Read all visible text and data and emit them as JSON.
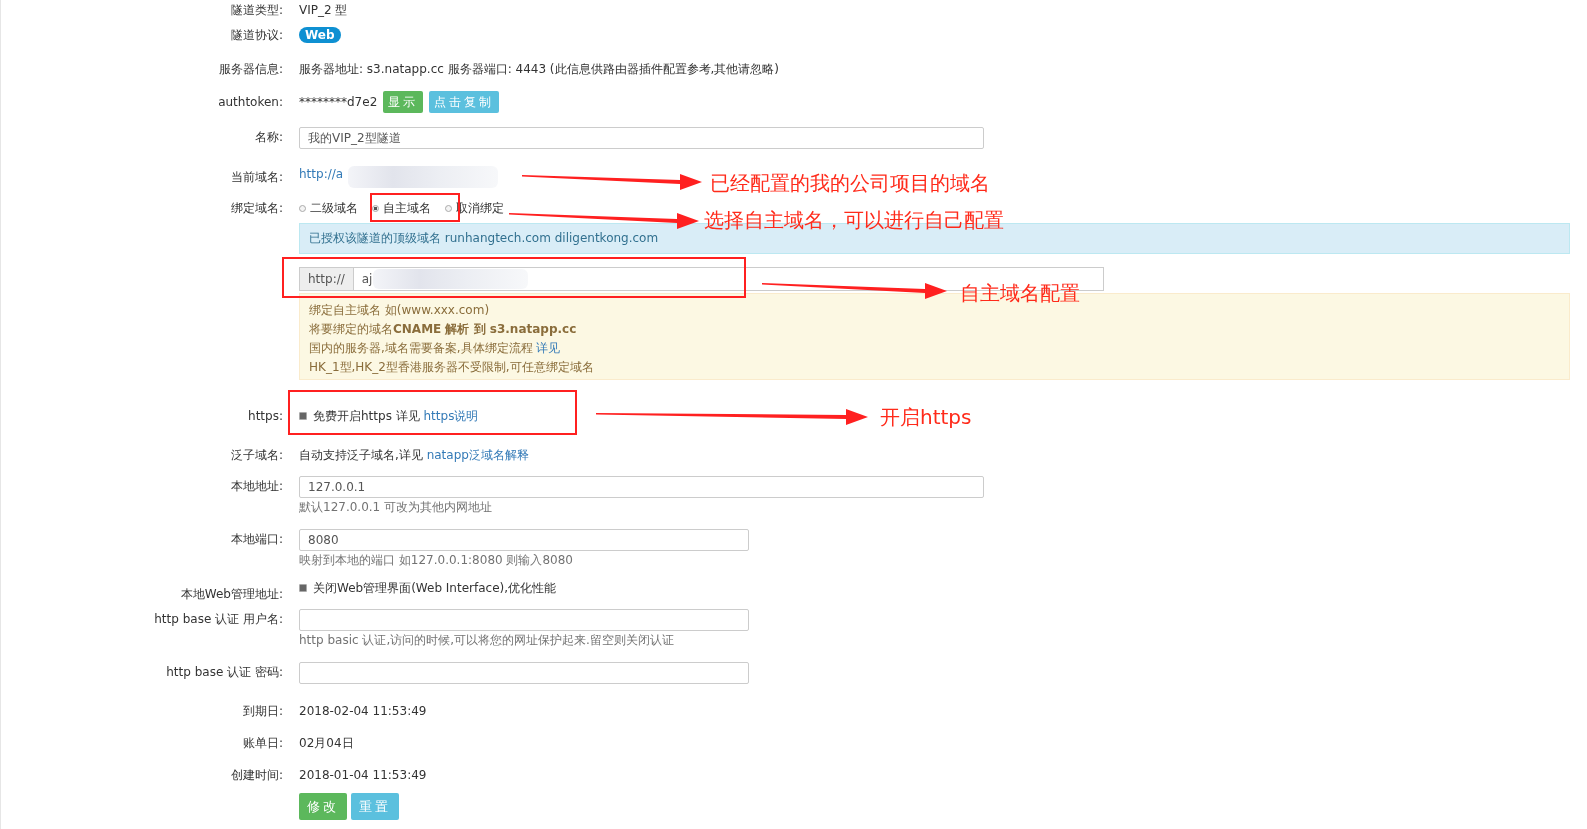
{
  "tunnel_type": {
    "label": "隧道类型:",
    "value": "VIP_2 型"
  },
  "protocol": {
    "label": "隧道协议:",
    "badge": "Web"
  },
  "server_info": {
    "label": "服务器信息:",
    "value": "服务器地址: s3.natapp.cc 服务器端口: 4443 (此信息供路由器插件配置参考,其他请忽略)"
  },
  "authtoken": {
    "label": "authtoken:",
    "value": "********d7e2",
    "buttons": [
      {
        "label": "显示",
        "kind": "success"
      },
      {
        "label": "点击复制",
        "kind": "info"
      }
    ]
  },
  "name": {
    "label": "名称:",
    "value": "我的VIP_2型隧道"
  },
  "current_domain": {
    "label": "当前域名:",
    "value": "http://a"
  },
  "bind_domain": {
    "label": "绑定域名:",
    "options": [
      {
        "label": "二级域名",
        "selected": false
      },
      {
        "label": "自主域名",
        "selected": true
      },
      {
        "label": "取消绑定",
        "selected": false
      }
    ],
    "info": "已授权该隧道的顶级域名 runhangtech.com  diligentkong.com",
    "addon": "http://",
    "value": "aj",
    "notes": [
      {
        "text": "绑定自主域名 如(www.xxx.com)"
      },
      {
        "text": "将要绑定的域名**CNAME 解析 到 s3.natapp.cc**"
      },
      {
        "text": "国内的服务器,域名需要备案,具体绑定流程 ",
        "link": "详见"
      },
      {
        "text": "HK_1型,HK_2型香港服务器不受限制,可任意绑定域名"
      }
    ]
  },
  "https": {
    "label": "https:",
    "checked": true,
    "text": "免费开启https 详见 ",
    "link": "https说明"
  },
  "wildcard": {
    "label": "泛子域名:",
    "text": "自动支持泛子域名,详见 ",
    "link": "natapp泛域名解释"
  },
  "local_address": {
    "label": "本地地址:",
    "value": "127.0.0.1",
    "help": "默认127.0.0.1 可改为其他内网地址"
  },
  "local_port": {
    "label": "本地端口:",
    "value": "8080",
    "help": "映射到本地的端口 如127.0.0.1:8080 则输入8080"
  },
  "web_admin": {
    "label": "本地Web管理地址:",
    "checked": true,
    "text": "关闭Web管理界面(Web Interface),优化性能"
  },
  "auth_user": {
    "label": "http base 认证 用户名:",
    "help": "http basic 认证,访问的时候,可以将您的网址保护起来.留空则关闭认证"
  },
  "auth_password": {
    "label": "http base 认证 密码:"
  },
  "expire": {
    "label": "到期日:",
    "value": "2018-02-04 11:53:49"
  },
  "bill_day": {
    "label": "账单日:",
    "value": "02月04日"
  },
  "created": {
    "label": "创建时间:",
    "value": "2018-01-04 11:53:49"
  },
  "actions": [
    {
      "label": "修改",
      "kind": "success"
    },
    {
      "label": "重置",
      "kind": "info"
    }
  ],
  "annotations": [
    "已经配置的我的公司项目的域名",
    "选择自主域名，可以进行自己配置",
    "自主域名配置",
    "开启https"
  ]
}
